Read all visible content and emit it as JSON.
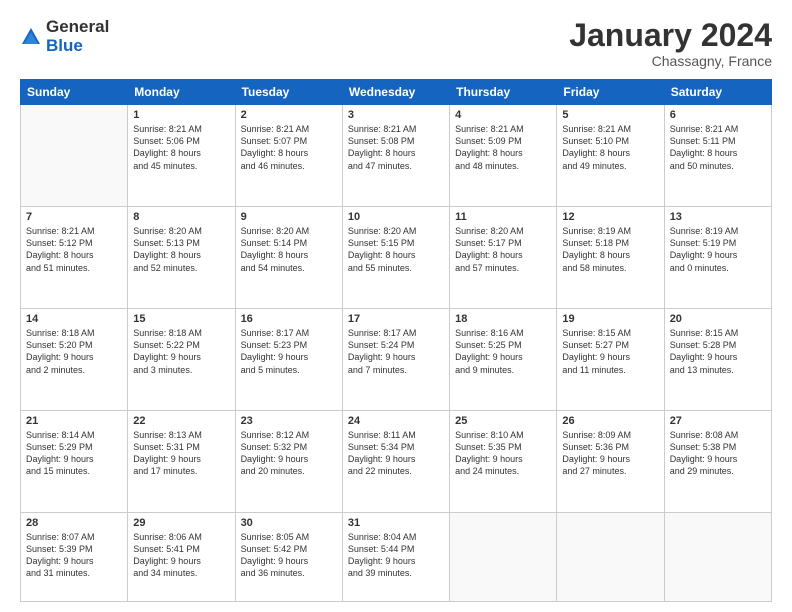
{
  "logo": {
    "general": "General",
    "blue": "Blue"
  },
  "title": "January 2024",
  "location": "Chassagny, France",
  "weekdays": [
    "Sunday",
    "Monday",
    "Tuesday",
    "Wednesday",
    "Thursday",
    "Friday",
    "Saturday"
  ],
  "weeks": [
    [
      {
        "day": "",
        "info": ""
      },
      {
        "day": "1",
        "info": "Sunrise: 8:21 AM\nSunset: 5:06 PM\nDaylight: 8 hours\nand 45 minutes."
      },
      {
        "day": "2",
        "info": "Sunrise: 8:21 AM\nSunset: 5:07 PM\nDaylight: 8 hours\nand 46 minutes."
      },
      {
        "day": "3",
        "info": "Sunrise: 8:21 AM\nSunset: 5:08 PM\nDaylight: 8 hours\nand 47 minutes."
      },
      {
        "day": "4",
        "info": "Sunrise: 8:21 AM\nSunset: 5:09 PM\nDaylight: 8 hours\nand 48 minutes."
      },
      {
        "day": "5",
        "info": "Sunrise: 8:21 AM\nSunset: 5:10 PM\nDaylight: 8 hours\nand 49 minutes."
      },
      {
        "day": "6",
        "info": "Sunrise: 8:21 AM\nSunset: 5:11 PM\nDaylight: 8 hours\nand 50 minutes."
      }
    ],
    [
      {
        "day": "7",
        "info": "Sunrise: 8:21 AM\nSunset: 5:12 PM\nDaylight: 8 hours\nand 51 minutes."
      },
      {
        "day": "8",
        "info": "Sunrise: 8:20 AM\nSunset: 5:13 PM\nDaylight: 8 hours\nand 52 minutes."
      },
      {
        "day": "9",
        "info": "Sunrise: 8:20 AM\nSunset: 5:14 PM\nDaylight: 8 hours\nand 54 minutes."
      },
      {
        "day": "10",
        "info": "Sunrise: 8:20 AM\nSunset: 5:15 PM\nDaylight: 8 hours\nand 55 minutes."
      },
      {
        "day": "11",
        "info": "Sunrise: 8:20 AM\nSunset: 5:17 PM\nDaylight: 8 hours\nand 57 minutes."
      },
      {
        "day": "12",
        "info": "Sunrise: 8:19 AM\nSunset: 5:18 PM\nDaylight: 8 hours\nand 58 minutes."
      },
      {
        "day": "13",
        "info": "Sunrise: 8:19 AM\nSunset: 5:19 PM\nDaylight: 9 hours\nand 0 minutes."
      }
    ],
    [
      {
        "day": "14",
        "info": "Sunrise: 8:18 AM\nSunset: 5:20 PM\nDaylight: 9 hours\nand 2 minutes."
      },
      {
        "day": "15",
        "info": "Sunrise: 8:18 AM\nSunset: 5:22 PM\nDaylight: 9 hours\nand 3 minutes."
      },
      {
        "day": "16",
        "info": "Sunrise: 8:17 AM\nSunset: 5:23 PM\nDaylight: 9 hours\nand 5 minutes."
      },
      {
        "day": "17",
        "info": "Sunrise: 8:17 AM\nSunset: 5:24 PM\nDaylight: 9 hours\nand 7 minutes."
      },
      {
        "day": "18",
        "info": "Sunrise: 8:16 AM\nSunset: 5:25 PM\nDaylight: 9 hours\nand 9 minutes."
      },
      {
        "day": "19",
        "info": "Sunrise: 8:15 AM\nSunset: 5:27 PM\nDaylight: 9 hours\nand 11 minutes."
      },
      {
        "day": "20",
        "info": "Sunrise: 8:15 AM\nSunset: 5:28 PM\nDaylight: 9 hours\nand 13 minutes."
      }
    ],
    [
      {
        "day": "21",
        "info": "Sunrise: 8:14 AM\nSunset: 5:29 PM\nDaylight: 9 hours\nand 15 minutes."
      },
      {
        "day": "22",
        "info": "Sunrise: 8:13 AM\nSunset: 5:31 PM\nDaylight: 9 hours\nand 17 minutes."
      },
      {
        "day": "23",
        "info": "Sunrise: 8:12 AM\nSunset: 5:32 PM\nDaylight: 9 hours\nand 20 minutes."
      },
      {
        "day": "24",
        "info": "Sunrise: 8:11 AM\nSunset: 5:34 PM\nDaylight: 9 hours\nand 22 minutes."
      },
      {
        "day": "25",
        "info": "Sunrise: 8:10 AM\nSunset: 5:35 PM\nDaylight: 9 hours\nand 24 minutes."
      },
      {
        "day": "26",
        "info": "Sunrise: 8:09 AM\nSunset: 5:36 PM\nDaylight: 9 hours\nand 27 minutes."
      },
      {
        "day": "27",
        "info": "Sunrise: 8:08 AM\nSunset: 5:38 PM\nDaylight: 9 hours\nand 29 minutes."
      }
    ],
    [
      {
        "day": "28",
        "info": "Sunrise: 8:07 AM\nSunset: 5:39 PM\nDaylight: 9 hours\nand 31 minutes."
      },
      {
        "day": "29",
        "info": "Sunrise: 8:06 AM\nSunset: 5:41 PM\nDaylight: 9 hours\nand 34 minutes."
      },
      {
        "day": "30",
        "info": "Sunrise: 8:05 AM\nSunset: 5:42 PM\nDaylight: 9 hours\nand 36 minutes."
      },
      {
        "day": "31",
        "info": "Sunrise: 8:04 AM\nSunset: 5:44 PM\nDaylight: 9 hours\nand 39 minutes."
      },
      {
        "day": "",
        "info": ""
      },
      {
        "day": "",
        "info": ""
      },
      {
        "day": "",
        "info": ""
      }
    ]
  ]
}
